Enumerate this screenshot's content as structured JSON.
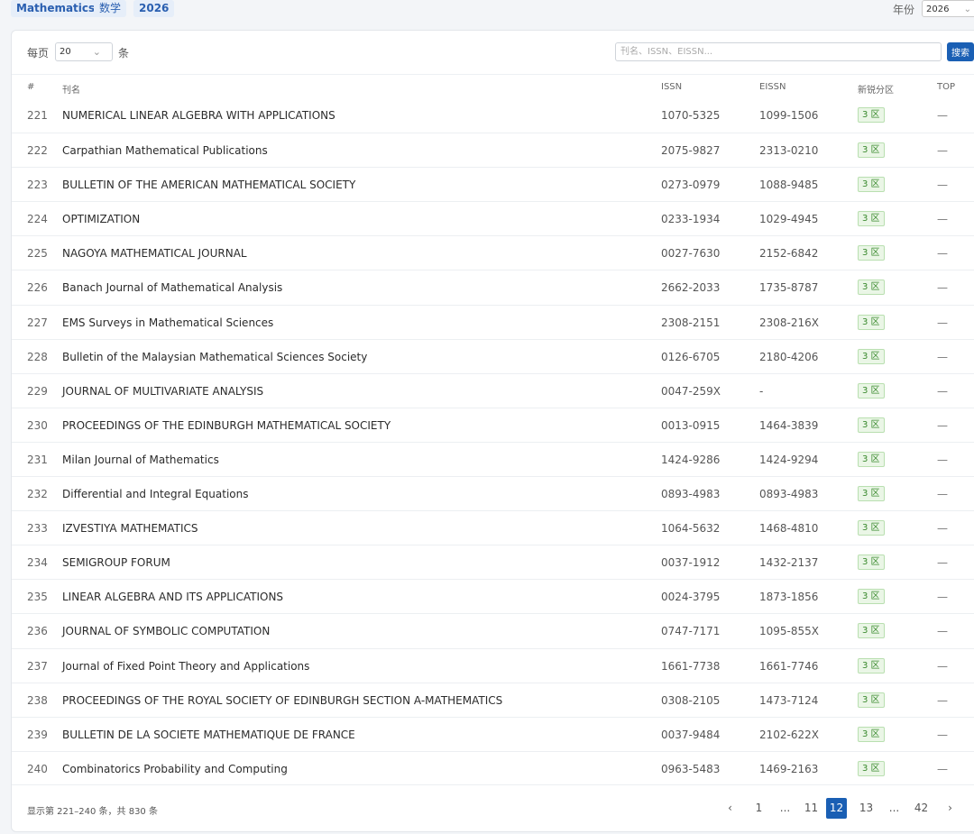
{
  "topbar": {
    "tags": [
      "Mathematics",
      "数学",
      "2026"
    ],
    "year_label": "年份",
    "year_value": "2026"
  },
  "toolbar": {
    "per_page_label": "每页",
    "per_page_value": "20",
    "per_page_unit": "条",
    "search_placeholder": "刊名、ISSN、EISSN...",
    "search_button": "搜索"
  },
  "table": {
    "columns": [
      "#",
      "刊名",
      "ISSN",
      "EISSN",
      "新锐分区",
      "TOP"
    ],
    "rows": [
      {
        "num": "221",
        "title": "NUMERICAL LINEAR ALGEBRA WITH APPLICATIONS",
        "issn": "1070-5325",
        "eissn": "1099-1506",
        "zone": "3 区",
        "top": "—"
      },
      {
        "num": "222",
        "title": "Carpathian Mathematical Publications",
        "issn": "2075-9827",
        "eissn": "2313-0210",
        "zone": "3 区",
        "top": "—"
      },
      {
        "num": "223",
        "title": "BULLETIN OF THE AMERICAN MATHEMATICAL SOCIETY",
        "issn": "0273-0979",
        "eissn": "1088-9485",
        "zone": "3 区",
        "top": "—"
      },
      {
        "num": "224",
        "title": "OPTIMIZATION",
        "issn": "0233-1934",
        "eissn": "1029-4945",
        "zone": "3 区",
        "top": "—"
      },
      {
        "num": "225",
        "title": "NAGOYA MATHEMATICAL JOURNAL",
        "issn": "0027-7630",
        "eissn": "2152-6842",
        "zone": "3 区",
        "top": "—"
      },
      {
        "num": "226",
        "title": "Banach Journal of Mathematical Analysis",
        "issn": "2662-2033",
        "eissn": "1735-8787",
        "zone": "3 区",
        "top": "—"
      },
      {
        "num": "227",
        "title": "EMS Surveys in Mathematical Sciences",
        "issn": "2308-2151",
        "eissn": "2308-216X",
        "zone": "3 区",
        "top": "—"
      },
      {
        "num": "228",
        "title": "Bulletin of the Malaysian Mathematical Sciences Society",
        "issn": "0126-6705",
        "eissn": "2180-4206",
        "zone": "3 区",
        "top": "—"
      },
      {
        "num": "229",
        "title": "JOURNAL OF MULTIVARIATE ANALYSIS",
        "issn": "0047-259X",
        "eissn": "-",
        "zone": "3 区",
        "top": "—"
      },
      {
        "num": "230",
        "title": "PROCEEDINGS OF THE EDINBURGH MATHEMATICAL SOCIETY",
        "issn": "0013-0915",
        "eissn": "1464-3839",
        "zone": "3 区",
        "top": "—"
      },
      {
        "num": "231",
        "title": "Milan Journal of Mathematics",
        "issn": "1424-9286",
        "eissn": "1424-9294",
        "zone": "3 区",
        "top": "—"
      },
      {
        "num": "232",
        "title": "Differential and Integral Equations",
        "issn": "0893-4983",
        "eissn": "0893-4983",
        "zone": "3 区",
        "top": "—"
      },
      {
        "num": "233",
        "title": "IZVESTIYA MATHEMATICS",
        "issn": "1064-5632",
        "eissn": "1468-4810",
        "zone": "3 区",
        "top": "—"
      },
      {
        "num": "234",
        "title": "SEMIGROUP FORUM",
        "issn": "0037-1912",
        "eissn": "1432-2137",
        "zone": "3 区",
        "top": "—"
      },
      {
        "num": "235",
        "title": "LINEAR ALGEBRA AND ITS APPLICATIONS",
        "issn": "0024-3795",
        "eissn": "1873-1856",
        "zone": "3 区",
        "top": "—"
      },
      {
        "num": "236",
        "title": "JOURNAL OF SYMBOLIC COMPUTATION",
        "issn": "0747-7171",
        "eissn": "1095-855X",
        "zone": "3 区",
        "top": "—"
      },
      {
        "num": "237",
        "title": "Journal of Fixed Point Theory and Applications",
        "issn": "1661-7738",
        "eissn": "1661-7746",
        "zone": "3 区",
        "top": "—"
      },
      {
        "num": "238",
        "title": "PROCEEDINGS OF THE ROYAL SOCIETY OF EDINBURGH SECTION A-MATHEMATICS",
        "issn": "0308-2105",
        "eissn": "1473-7124",
        "zone": "3 区",
        "top": "—"
      },
      {
        "num": "239",
        "title": "BULLETIN DE LA SOCIETE MATHEMATIQUE DE FRANCE",
        "issn": "0037-9484",
        "eissn": "2102-622X",
        "zone": "3 区",
        "top": "—"
      },
      {
        "num": "240",
        "title": "Combinatorics Probability and Computing",
        "issn": "0963-5483",
        "eissn": "1469-2163",
        "zone": "3 区",
        "top": "—"
      }
    ]
  },
  "footer": {
    "summary": "显示第 221–240 条，共 830 条",
    "pages": [
      "‹",
      "1",
      "...",
      "11",
      "12",
      "13",
      "...",
      "42",
      "›"
    ],
    "active_page": "12"
  },
  "colors": {
    "accent": "#1a5fb4",
    "zone_bg": "#eaf6e6",
    "zone_text": "#3a8a2e"
  }
}
